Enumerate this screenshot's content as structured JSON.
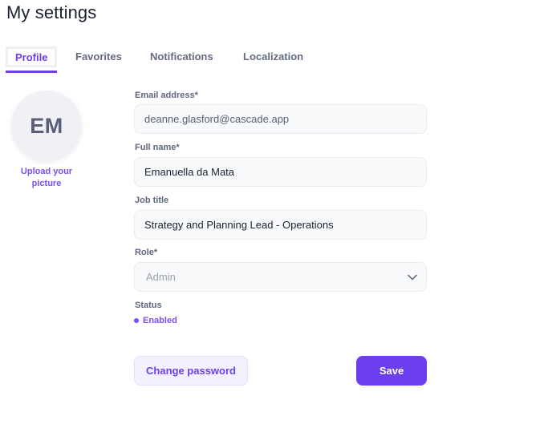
{
  "header": {
    "title": "My settings"
  },
  "tabs": [
    {
      "label": "Profile",
      "active": true
    },
    {
      "label": "Favorites",
      "active": false
    },
    {
      "label": "Notifications",
      "active": false
    },
    {
      "label": "Localization",
      "active": false
    }
  ],
  "profile": {
    "avatar_initials": "EM",
    "upload_label": "Upload your picture"
  },
  "form": {
    "email": {
      "label": "Email address*",
      "value": "deanne.glasford@cascade.app"
    },
    "full_name": {
      "label": "Full name*",
      "value": "Emanuella da Mata"
    },
    "job_title": {
      "label": "Job title",
      "value": "Strategy and Planning Lead - Operations"
    },
    "role": {
      "label": "Role*",
      "value": "Admin",
      "icon": "chevron-down-icon"
    },
    "status": {
      "label": "Status",
      "value": "Enabled",
      "color": "#7a4cf2"
    }
  },
  "actions": {
    "change_password_label": "Change password",
    "save_label": "Save"
  },
  "colors": {
    "accent": "#6b3ff0",
    "text_primary": "#1c2131",
    "text_muted": "#5f6680"
  }
}
